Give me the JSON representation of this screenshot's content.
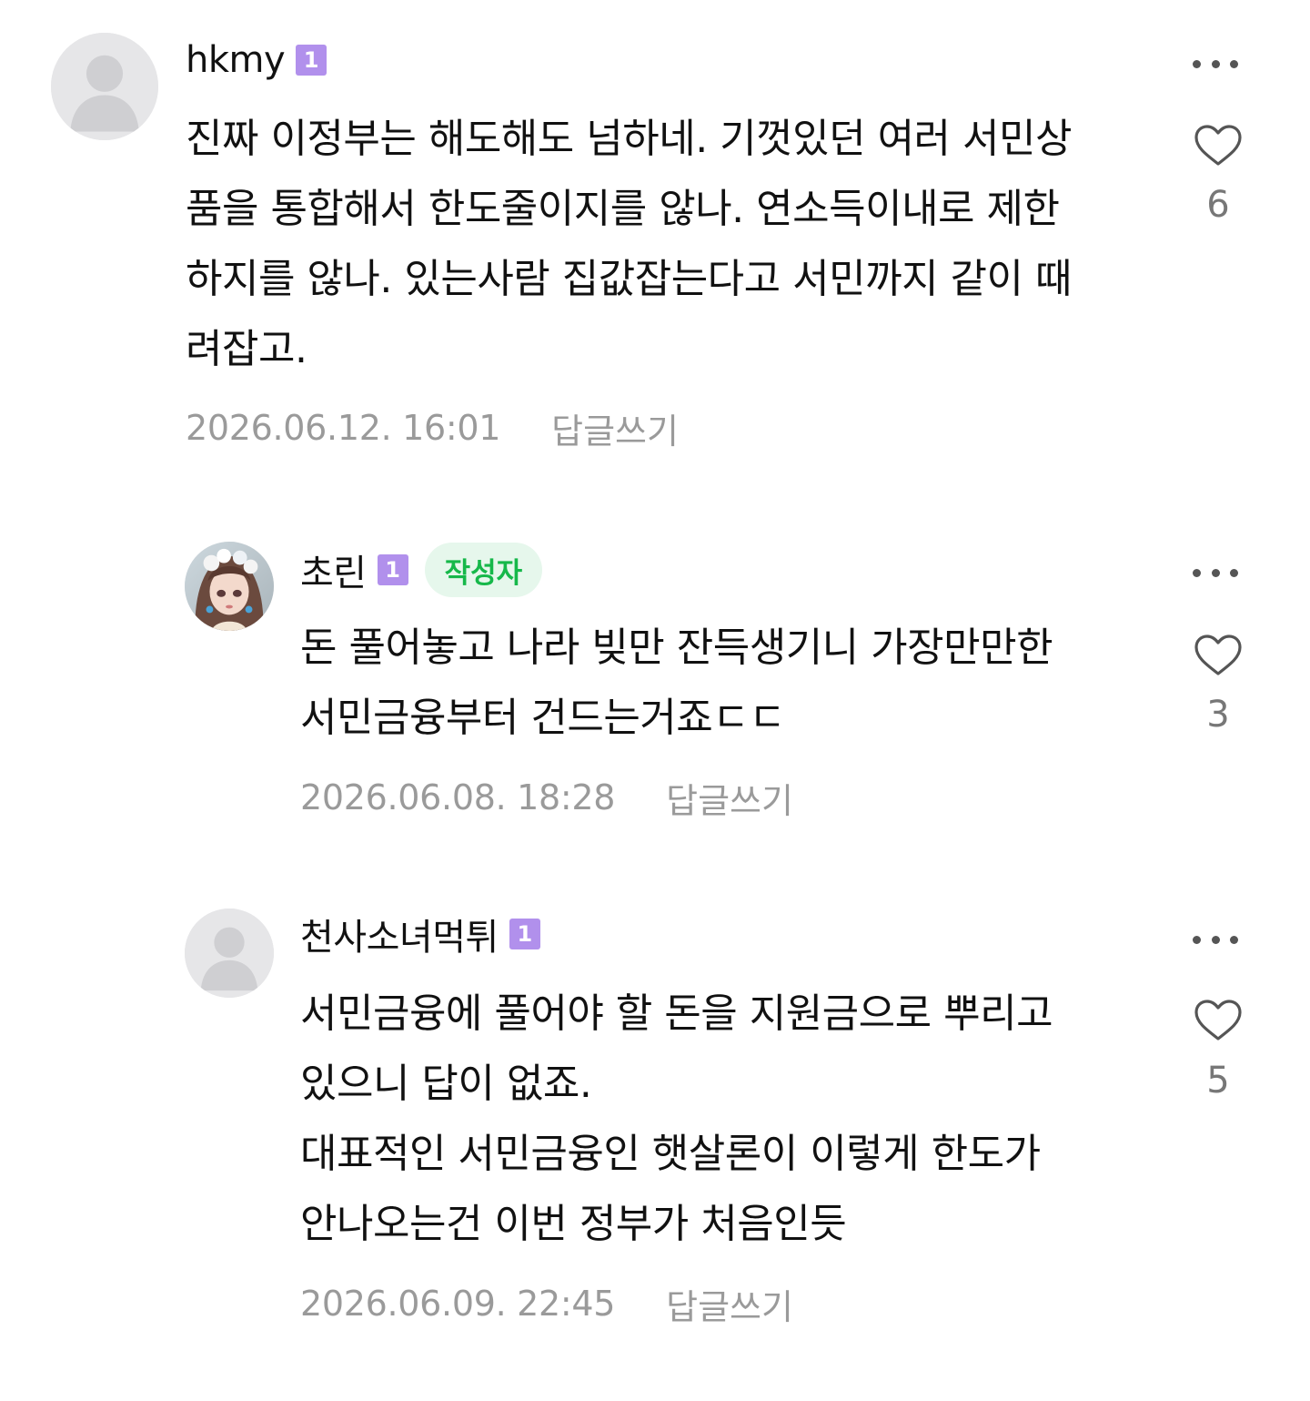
{
  "comments": [
    {
      "username": "hkmy",
      "level": "1",
      "author_badge": "",
      "text_lines": [
        "진짜 이정부는 해도해도 넘하네. 기껏있던 여러 서민상",
        "품을 통합해서 한도줄이지를 않나. 연소득이내로 제한",
        "하지를 않나. 있는사람 집값잡는다고 서민까지 같이 때",
        "려잡고."
      ],
      "timestamp": "2026.06.12. 16:01",
      "reply_label": "답글쓰기",
      "likes": "6",
      "avatar": "default-avatar"
    },
    {
      "username": "초린",
      "level": "1",
      "author_badge": "작성자",
      "text_lines": [
        "돈 풀어놓고 나라 빚만 잔득생기니 가장만만한",
        "서민금융부터 건드는거죠ㄷㄷ"
      ],
      "timestamp": "2026.06.08. 18:28",
      "reply_label": "답글쓰기",
      "likes": "3",
      "avatar": "profile-photo"
    },
    {
      "username": "천사소녀먹튀",
      "level": "1",
      "author_badge": "",
      "text_lines": [
        "서민금융에 풀어야 할 돈을 지원금으로 뿌리고",
        "있으니 답이 없죠.",
        "대표적인 서민금융인 햇살론이 이렇게 한도가",
        "안나오는건 이번 정부가 처음인듯"
      ],
      "timestamp": "2026.06.09. 22:45",
      "reply_label": "답글쓰기",
      "likes": "5",
      "avatar": "default-avatar"
    }
  ]
}
